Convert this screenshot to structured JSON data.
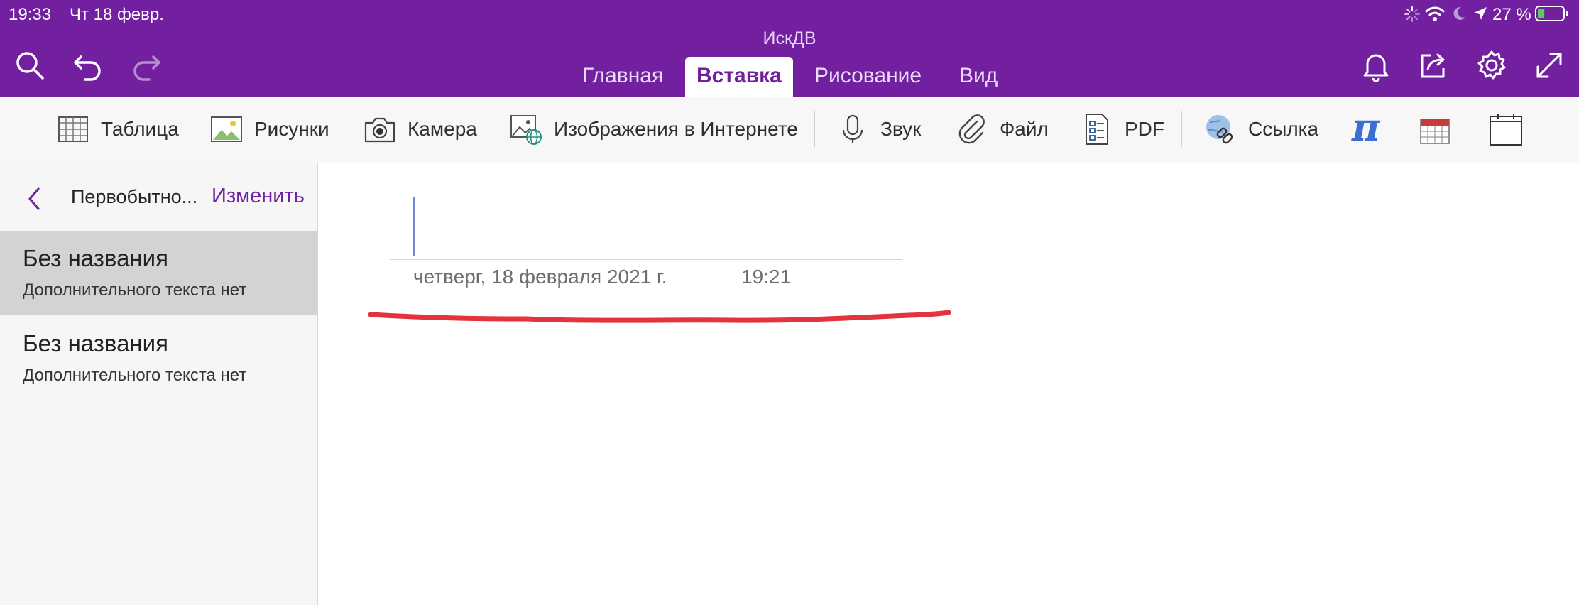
{
  "status_bar": {
    "time": "19:33",
    "date": "Чт 18 февр.",
    "battery": "27 %",
    "battery_level": 0.27,
    "icons": [
      "activity-spinner-icon",
      "wifi-icon",
      "moon-icon",
      "location-arrow-icon",
      "battery-icon"
    ]
  },
  "app": {
    "title": "ИскДВ"
  },
  "toolbar": {
    "left_icons": [
      "search-icon",
      "undo-icon",
      "redo-icon"
    ],
    "right_icons": [
      "bell-icon",
      "share-icon",
      "gear-icon",
      "expand-icon"
    ]
  },
  "tabs": [
    {
      "label": "Главная",
      "active": false
    },
    {
      "label": "Вставка",
      "active": true
    },
    {
      "label": "Рисование",
      "active": false
    },
    {
      "label": "Вид",
      "active": false
    }
  ],
  "ribbon": {
    "items": [
      {
        "label": "Таблица",
        "icon": "table-icon"
      },
      {
        "label": "Рисунки",
        "icon": "picture-icon"
      },
      {
        "label": "Камера",
        "icon": "camera-icon"
      },
      {
        "label": "Изображения в Интернете",
        "icon": "online-image-icon"
      },
      {
        "label": "Звук",
        "icon": "microphone-icon"
      },
      {
        "label": "Файл",
        "icon": "paperclip-icon"
      },
      {
        "label": "PDF",
        "icon": "pdf-icon"
      },
      {
        "label": "Ссылка",
        "icon": "link-icon"
      }
    ],
    "equation_glyph": "π",
    "extra_icons": [
      "equation-icon",
      "date-icon",
      "time-icon"
    ]
  },
  "sidebar": {
    "section_title": "Первобытно...",
    "edit_label": "Изменить",
    "pages": [
      {
        "title": "Без названия",
        "subtitle": "Дополнительного текста нет",
        "selected": true
      },
      {
        "title": "Без названия",
        "subtitle": "Дополнительного текста нет",
        "selected": false
      }
    ]
  },
  "note": {
    "date": "четверг, 18 февраля 2021 г.",
    "time": "19:21",
    "annotation_color": "#e5333d"
  },
  "colors": {
    "accent": "#7220a0",
    "caret": "#6f86d9"
  }
}
